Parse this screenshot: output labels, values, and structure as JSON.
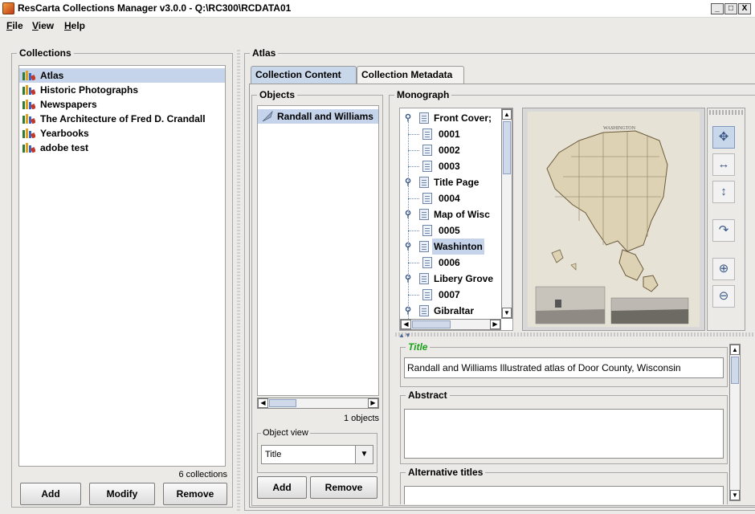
{
  "window": {
    "title": "ResCarta Collections Manager v3.0.0 - Q:\\RC300\\RCDATA01",
    "min": "_",
    "max": "□",
    "close": "X"
  },
  "menu": [
    {
      "label": "File",
      "key": "F",
      "rest": "ile"
    },
    {
      "label": "View",
      "key": "V",
      "rest": "iew"
    },
    {
      "label": "Help",
      "key": "H",
      "rest": "elp"
    }
  ],
  "collections": {
    "title": "Collections",
    "items": [
      "Atlas",
      "Historic Photographs",
      "Newspapers",
      "The Architecture of Fred D. Crandall",
      "Yearbooks",
      "adobe test"
    ],
    "selected": 0,
    "count": "6 collections",
    "buttons": {
      "add": "Add",
      "modify": "Modify",
      "remove": "Remove"
    }
  },
  "right": {
    "title": "Atlas",
    "tabs": [
      "Collection Content",
      "Collection Metadata"
    ],
    "active_tab": 0
  },
  "objects": {
    "title": "Objects",
    "items": [
      "Randall and Williams"
    ],
    "count": "1 objects",
    "view_label": "Object view",
    "view_value": "Title",
    "buttons": {
      "add": "Add",
      "remove": "Remove"
    }
  },
  "monograph": {
    "title": "Monograph",
    "tree": [
      {
        "label": "Front Cover;",
        "level": 0
      },
      {
        "label": "0001",
        "level": 1
      },
      {
        "label": "0002",
        "level": 1
      },
      {
        "label": "0003",
        "level": 1
      },
      {
        "label": "Title Page",
        "level": 0
      },
      {
        "label": "0004",
        "level": 1
      },
      {
        "label": "Map of Wisc",
        "level": 0
      },
      {
        "label": "0005",
        "level": 1
      },
      {
        "label": "Washinton",
        "level": 0,
        "selected": true
      },
      {
        "label": "0006",
        "level": 1
      },
      {
        "label": "Libery Grove",
        "level": 0
      },
      {
        "label": "0007",
        "level": 1
      },
      {
        "label": "Gibraltar",
        "level": 0
      }
    ],
    "map_caption": "WASHINGTON",
    "tools": [
      "pan-icon",
      "fit-width-icon",
      "fit-height-icon",
      "rotate-icon",
      "zoom-in-icon",
      "zoom-out-icon"
    ]
  },
  "metadata": {
    "title_label": "Title",
    "title_value": "Randall and Williams Illustrated atlas of Door County, Wisconsin",
    "abstract_label": "Abstract",
    "abstract_value": "",
    "alt_titles_label": "Alternative titles",
    "title_color": "#1aa21a"
  }
}
